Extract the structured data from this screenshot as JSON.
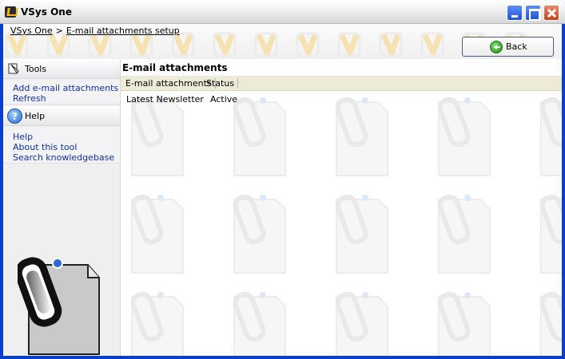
{
  "window": {
    "title": "VSys One"
  },
  "breadcrumb": {
    "root": "VSys One",
    "separator": ">",
    "current": "E-mail attachments setup"
  },
  "toolbar": {
    "back_label": "Back"
  },
  "sidebar": {
    "tools": {
      "title": "Tools",
      "links": [
        "Add e-mail attachments",
        "Refresh"
      ]
    },
    "help": {
      "title": "Help",
      "links": [
        "Help",
        "About this tool",
        "Search knowledgebase"
      ]
    }
  },
  "main": {
    "title": "E-mail attachments",
    "columns": [
      "E-mail attachments",
      "Status"
    ],
    "rows": [
      {
        "name": "Latest Newsletter",
        "status": "Active"
      }
    ]
  },
  "colors": {
    "titlebar": "#e8e8e8",
    "frame": "#0a3fc8",
    "link": "#1030a8",
    "column_header": "#edebd6",
    "logo_accent": "#f3b31b"
  }
}
